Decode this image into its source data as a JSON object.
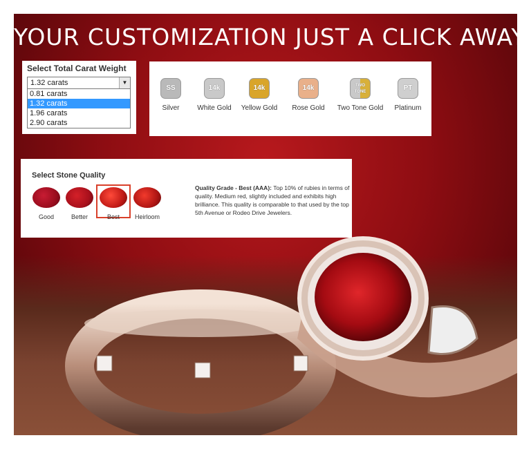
{
  "headline": "YOUR CUSTOMIZATION JUST A CLICK AWAY",
  "carat": {
    "title": "Select Total Carat Weight",
    "selected": "1.32 carats",
    "options": [
      "0.81 carats",
      "1.32 carats",
      "1.96 carats",
      "2.90 carats"
    ]
  },
  "metals": [
    {
      "label": "Silver",
      "badge": "SS",
      "color": "#b9b9b9"
    },
    {
      "label": "White Gold",
      "badge": "14k",
      "color": "#c9c9c9"
    },
    {
      "label": "Yellow Gold",
      "badge": "14k",
      "color": "#d9a52a"
    },
    {
      "label": "Rose Gold",
      "badge": "14k",
      "color": "#e9b08a"
    },
    {
      "label": "Two Tone Gold",
      "badge": "TWO TONE",
      "color": "#d8b03a"
    },
    {
      "label": "Platinum",
      "badge": "PT",
      "color": "#cfcfcf"
    }
  ],
  "quality": {
    "title": "Select Stone Quality",
    "stones": [
      {
        "label": "Good",
        "color": "#9a0d1e"
      },
      {
        "label": "Better",
        "color": "#a8101c"
      },
      {
        "label": "Best",
        "color": "#c11a16"
      },
      {
        "label": "Heirloom",
        "color": "#b01614"
      }
    ],
    "selected": "Best",
    "description_heading": "Quality Grade - Best (AAA):",
    "description_body": "Top 10% of rubies in terms of quality.  Medium red, slightly included and exhibits high brilliance.  This quality is comparable to that used by the top 5th Avenue or Rodeo Drive Jewelers."
  },
  "colors": {
    "banner_red": "#8e0d12",
    "select_highlight": "#3399ff",
    "selected_border": "#d9402a"
  }
}
